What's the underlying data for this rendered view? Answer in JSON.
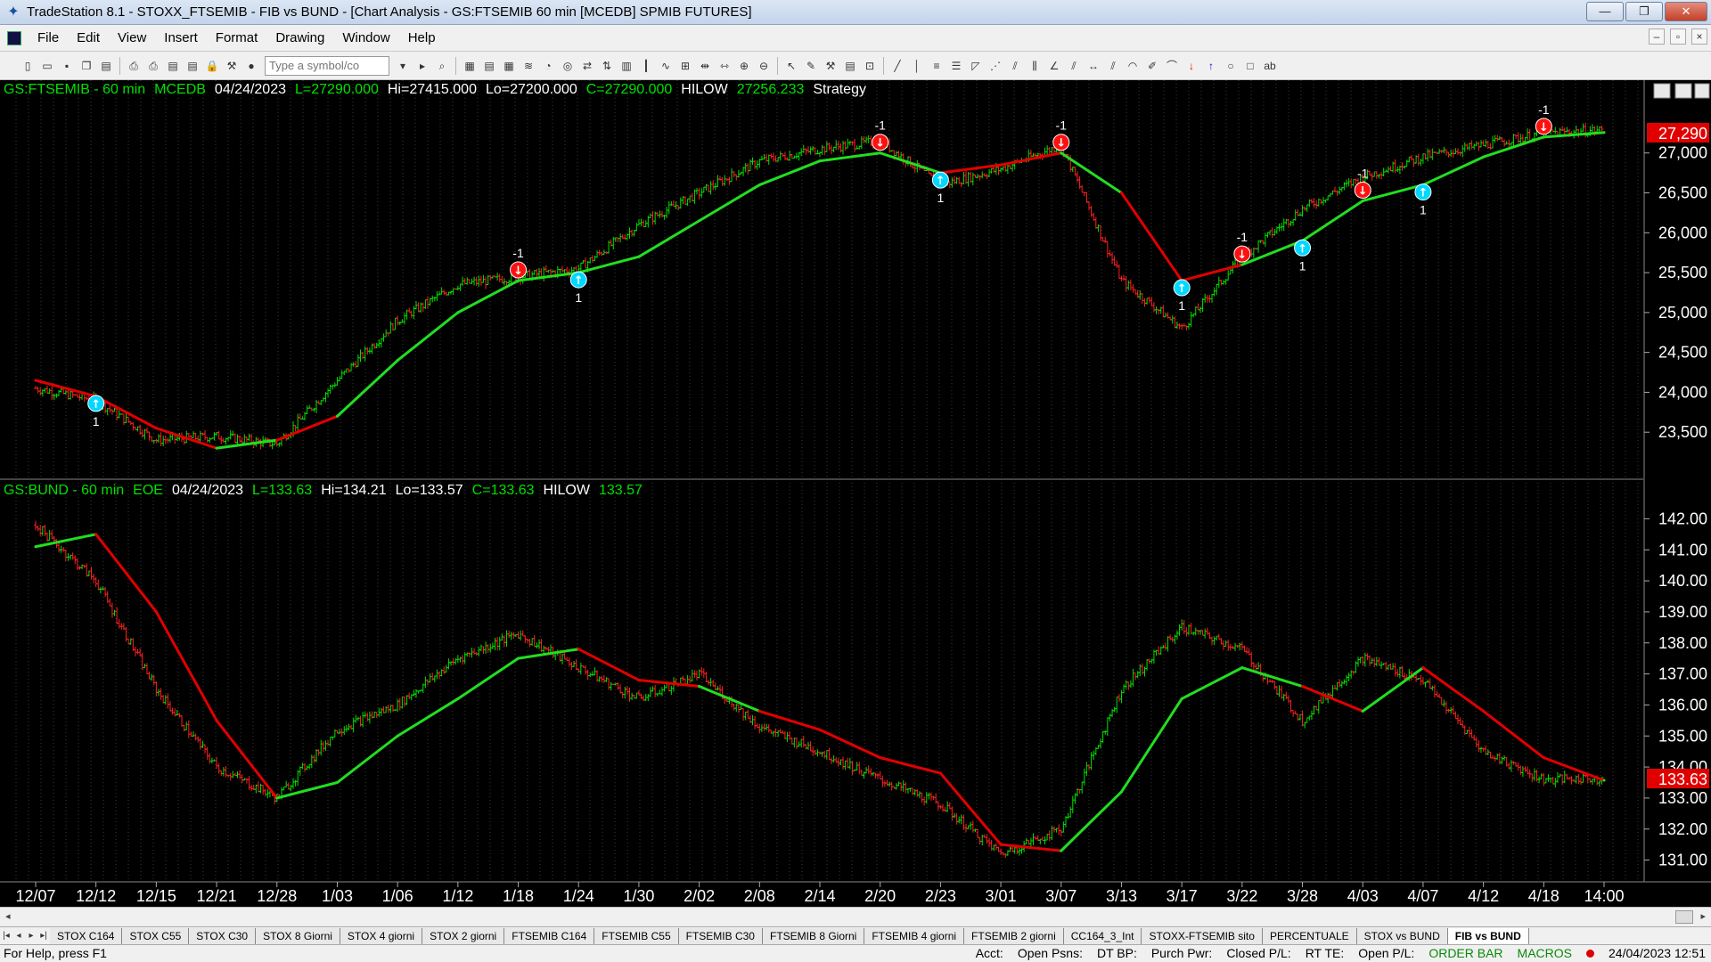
{
  "window": {
    "title": "TradeStation 8.1 - STOXX_FTSEMIB - FIB vs BUND - [Chart Analysis - GS:FTSEMIB  60 min  [MCEDB] SPMIB FUTURES]",
    "btn_min": "—",
    "btn_max": "❐",
    "btn_close": "✕"
  },
  "menu": [
    "File",
    "Edit",
    "View",
    "Insert",
    "Format",
    "Drawing",
    "Window",
    "Help"
  ],
  "toolbar": {
    "symbol_placeholder": "Type a symbol/co"
  },
  "top_panel": {
    "header_parts": [
      {
        "text": "GS:FTSEMIB - 60 min",
        "color": "#00e000"
      },
      {
        "text": "MCEDB",
        "color": "#00e000"
      },
      {
        "text": "04/24/2023",
        "color": "#ffffff"
      },
      {
        "text": "L=27290.000",
        "color": "#00e000"
      },
      {
        "text": "Hi=27415.000",
        "color": "#ffffff"
      },
      {
        "text": "Lo=27200.000",
        "color": "#ffffff"
      },
      {
        "text": "C=27290.000",
        "color": "#00e000"
      },
      {
        "text": "HILOW",
        "color": "#ffffff"
      },
      {
        "text": "27256.233",
        "color": "#00e000"
      },
      {
        "text": "Strategy",
        "color": "#ffffff"
      }
    ],
    "y_ticks": [
      "27,000",
      "26,500",
      "26,000",
      "25,500",
      "25,000",
      "24,500",
      "24,000",
      "23,500"
    ],
    "last_price": "27,290"
  },
  "bottom_panel": {
    "header_parts": [
      {
        "text": "GS:BUND - 60 min",
        "color": "#00e000"
      },
      {
        "text": "EOE",
        "color": "#00e000"
      },
      {
        "text": "04/24/2023",
        "color": "#ffffff"
      },
      {
        "text": "L=133.63",
        "color": "#00e000"
      },
      {
        "text": "Hi=134.21",
        "color": "#ffffff"
      },
      {
        "text": "Lo=133.57",
        "color": "#ffffff"
      },
      {
        "text": "C=133.63",
        "color": "#00e000"
      },
      {
        "text": "HILOW",
        "color": "#ffffff"
      },
      {
        "text": "133.57",
        "color": "#00e000"
      }
    ],
    "y_ticks": [
      "142.00",
      "141.00",
      "140.00",
      "139.00",
      "138.00",
      "137.00",
      "136.00",
      "135.00",
      "134.00",
      "133.00",
      "132.00",
      "131.00"
    ],
    "last_price": "133.63"
  },
  "x_ticks": [
    "12/07",
    "12/12",
    "12/15",
    "12/21",
    "12/28",
    "1/03",
    "1/06",
    "1/12",
    "1/18",
    "1/24",
    "1/30",
    "2/02",
    "2/08",
    "2/14",
    "2/20",
    "2/23",
    "3/01",
    "3/07",
    "3/13",
    "3/17",
    "3/22",
    "3/28",
    "4/03",
    "4/07",
    "4/12",
    "4/18",
    "14:00"
  ],
  "chart_data": [
    {
      "type": "line",
      "title": "GS:FTSEMIB - 60 min",
      "x": [
        "12/07",
        "12/12",
        "12/15",
        "12/21",
        "12/28",
        "1/03",
        "1/06",
        "1/12",
        "1/18",
        "1/24",
        "1/30",
        "2/02",
        "2/08",
        "2/14",
        "2/20",
        "2/23",
        "3/01",
        "3/07",
        "3/13",
        "3/17",
        "3/22",
        "3/28",
        "4/03",
        "4/07",
        "4/12",
        "4/18",
        "14:00"
      ],
      "ylim": [
        23000,
        27600
      ],
      "series": [
        {
          "name": "GS:FTSEMIB",
          "values": [
            24050,
            23900,
            23400,
            23450,
            23350,
            24150,
            24900,
            25350,
            25450,
            25550,
            26100,
            26500,
            26900,
            27050,
            27150,
            26600,
            26800,
            27100,
            25400,
            24800,
            25700,
            26300,
            26700,
            26950,
            27100,
            27250,
            27290
          ]
        },
        {
          "name": "HILOW",
          "values": [
            24150,
            23950,
            23550,
            23300,
            23400,
            23700,
            24400,
            25000,
            25400,
            25500,
            25700,
            26150,
            26600,
            26900,
            27000,
            26750,
            26850,
            27000,
            26500,
            25400,
            25600,
            25900,
            26400,
            26600,
            26950,
            27200,
            27256
          ]
        }
      ],
      "signals": [
        {
          "x": "12/12",
          "type": "buy",
          "label": "1"
        },
        {
          "x": "1/18",
          "type": "sell",
          "label": "-1"
        },
        {
          "x": "1/24",
          "type": "buy",
          "label": "1"
        },
        {
          "x": "2/20",
          "type": "sell",
          "label": "-1"
        },
        {
          "x": "2/23",
          "type": "buy",
          "label": "1"
        },
        {
          "x": "3/07",
          "type": "sell",
          "label": "-1"
        },
        {
          "x": "3/17",
          "type": "buy",
          "label": "1"
        },
        {
          "x": "3/22",
          "type": "sell",
          "label": "-1"
        },
        {
          "x": "3/28",
          "type": "buy",
          "label": "1"
        },
        {
          "x": "4/03",
          "type": "sell",
          "label": "-1"
        },
        {
          "x": "4/07",
          "type": "buy",
          "label": "1"
        },
        {
          "x": "4/18",
          "type": "sell",
          "label": "-1"
        }
      ]
    },
    {
      "type": "line",
      "title": "GS:BUND - 60 min",
      "x": [
        "12/07",
        "12/12",
        "12/15",
        "12/21",
        "12/28",
        "1/03",
        "1/06",
        "1/12",
        "1/18",
        "1/24",
        "1/30",
        "2/02",
        "2/08",
        "2/14",
        "2/20",
        "2/23",
        "3/01",
        "3/07",
        "3/13",
        "3/17",
        "3/22",
        "3/28",
        "4/03",
        "4/07",
        "4/12",
        "4/18",
        "14:00"
      ],
      "ylim": [
        130.5,
        142.5
      ],
      "series": [
        {
          "name": "GS:BUND",
          "values": [
            141.8,
            140.0,
            136.5,
            134.0,
            133.0,
            135.2,
            136.0,
            137.5,
            138.3,
            137.2,
            136.2,
            137.0,
            135.3,
            134.5,
            133.6,
            132.8,
            131.2,
            132.0,
            136.5,
            138.5,
            137.8,
            135.5,
            137.5,
            136.8,
            134.5,
            133.6,
            133.63
          ]
        },
        {
          "name": "HILOW",
          "values": [
            141.1,
            141.5,
            139.0,
            135.5,
            133.0,
            133.5,
            135.0,
            136.2,
            137.5,
            137.8,
            136.8,
            136.6,
            135.8,
            135.2,
            134.3,
            133.8,
            131.5,
            131.3,
            133.2,
            136.2,
            137.2,
            136.6,
            135.8,
            137.2,
            135.8,
            134.3,
            133.57
          ]
        }
      ]
    }
  ],
  "tabs": [
    "STOX C164",
    "STOX C55",
    "STOX  C30",
    "STOX  8 Giorni",
    "STOX 4 giorni",
    "STOX  2 giorni",
    "FTSEMIB C164",
    "FTSEMIB C55",
    "FTSEMIB C30",
    "FTSEMIB  8 Giorni",
    "FTSEMIB  4 giorni",
    "FTSEMIB  2 giorni",
    "CC164_3_Int",
    "STOXX-FTSEMIB sito",
    "PERCENTUALE",
    "STOX vs BUND",
    "FIB vs BUND"
  ],
  "active_tab": "FIB vs BUND",
  "status": {
    "help": "For Help, press F1",
    "acct": "Acct:",
    "open_psns": "Open Psns:",
    "dt_bp": "DT BP:",
    "purch_pwr": "Purch Pwr:",
    "closed_pl": "Closed P/L:",
    "rt_te": "RT TE:",
    "open_pl": "Open P/L:",
    "order_bar": "ORDER BAR",
    "macros": "MACROS",
    "datetime": "24/04/2023 12:51"
  },
  "colors": {
    "up": "#00e000",
    "down": "#ff2020",
    "hilow_up": "#22dd22",
    "hilow_down": "#e00000",
    "grid": "#3a3a3a",
    "buy": "#00d8ff",
    "sell": "#ff1010"
  }
}
